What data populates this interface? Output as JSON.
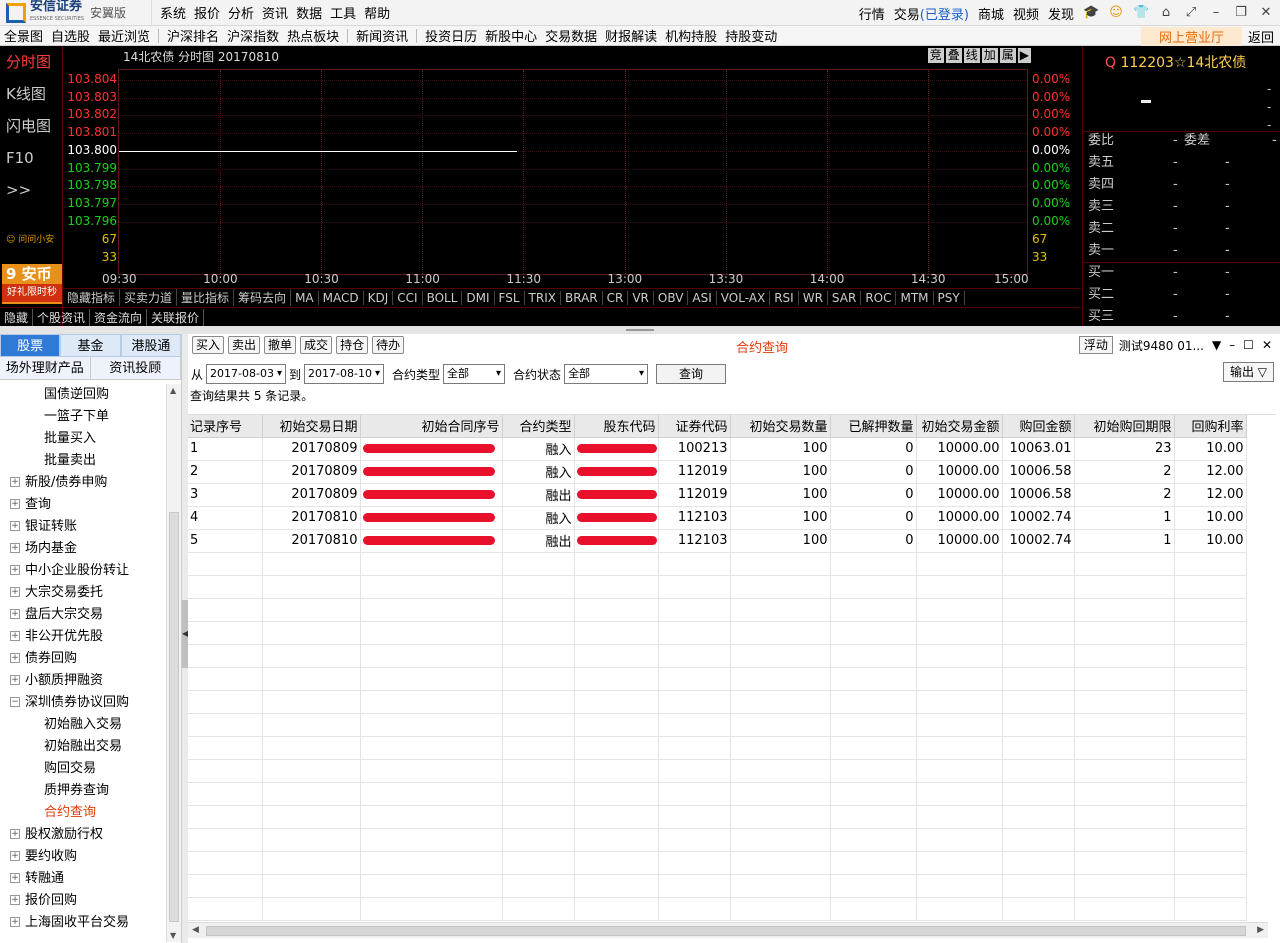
{
  "app": {
    "brand": "安信证券",
    "brand_en": "ESSENCE SECURITIES",
    "edition": "安翼版"
  },
  "menu": [
    "系统",
    "报价",
    "分析",
    "资讯",
    "数据",
    "工具",
    "帮助"
  ],
  "topright": {
    "market": "行情",
    "trade": "交易",
    "login_status": "(已登录)",
    "mall": "商城",
    "video": "视频",
    "discover": "发现"
  },
  "nav": {
    "items": [
      "全景图",
      "自选股",
      "最近浏览",
      "沪深排名",
      "沪深指数",
      "热点板块",
      "新闻资讯",
      "投资日历",
      "新股中心",
      "交易数据",
      "财报解读",
      "机构持股",
      "持股变动"
    ],
    "online_hall": "网上营业厅",
    "back": "返回"
  },
  "left_tabs": [
    "分时图",
    "K线图",
    "闪电图",
    "F10",
    ">>"
  ],
  "ask": "问问小安",
  "coin": {
    "num": "9",
    "label": "安币",
    "promo": "好礼限时秒"
  },
  "chart": {
    "title": "14北农债 分时图 20170810",
    "tools": [
      "竞",
      "叠",
      "线",
      "加",
      "属",
      "▶"
    ]
  },
  "chart_data": {
    "type": "line",
    "title": "14北农债 分时图 20170810",
    "x_ticks": [
      "09:30",
      "10:00",
      "10:30",
      "11:00",
      "11:30",
      "13:00",
      "13:30",
      "14:00",
      "14:30",
      "15:00"
    ],
    "y_ticks": [
      "103.804",
      "103.803",
      "103.802",
      "103.801",
      "103.800",
      "103.799",
      "103.798",
      "103.797",
      "103.796"
    ],
    "pct_ticks": [
      "0.00%",
      "0.00%",
      "0.00%",
      "0.00%",
      "0.00%",
      "0.00%",
      "0.00%",
      "0.00%",
      "0.00%"
    ],
    "volume_ticks": [
      "67",
      "33"
    ],
    "ylim": [
      103.796,
      103.804
    ],
    "series": [
      {
        "x": [
          "09:30",
          "11:15"
        ],
        "y": [
          103.8,
          103.8
        ]
      }
    ],
    "colors": {
      "up": "#ff3030",
      "flat": "#ffffff",
      "down": "#19d019",
      "volume": "#e0c000"
    }
  },
  "indicators": [
    "隐藏指标",
    "买卖力道",
    "量比指标",
    "筹码去向",
    "MA",
    "MACD",
    "KDJ",
    "CCI",
    "BOLL",
    "DMI",
    "FSL",
    "TRIX",
    "BRAR",
    "CR",
    "VR",
    "OBV",
    "ASI",
    "VOL-AX",
    "RSI",
    "WR",
    "SAR",
    "ROC",
    "MTM",
    "PSY"
  ],
  "subtabs": [
    "隐藏",
    "个股资讯",
    "资金流向",
    "关联报价"
  ],
  "quote": {
    "code": "112203",
    "name": "☆14北农债",
    "q": "Q",
    "commission_ratio": "委比",
    "commission_diff": "委差",
    "rows": [
      {
        "label": "卖五",
        "price": "-",
        "vol": "-"
      },
      {
        "label": "卖四",
        "price": "-",
        "vol": "-"
      },
      {
        "label": "卖三",
        "price": "-",
        "vol": "-"
      },
      {
        "label": "卖二",
        "price": "-",
        "vol": "-"
      },
      {
        "label": "卖一",
        "price": "-",
        "vol": "-"
      },
      {
        "label": "买一",
        "price": "-",
        "vol": "-"
      },
      {
        "label": "买二",
        "price": "-",
        "vol": "-"
      },
      {
        "label": "买三",
        "price": "-",
        "vol": "-"
      }
    ]
  },
  "categories": {
    "tabs": [
      "股票",
      "基金",
      "港股通"
    ],
    "tabs2": [
      "场外理财产品",
      "资讯投顾"
    ]
  },
  "tree": [
    {
      "type": "child",
      "label": "国债逆回购"
    },
    {
      "type": "child",
      "label": "一篮子下单"
    },
    {
      "type": "child",
      "label": "批量买入"
    },
    {
      "type": "child",
      "label": "批量卖出"
    },
    {
      "type": "parent",
      "pm": "+",
      "label": "新股/债券申购"
    },
    {
      "type": "parent",
      "pm": "+",
      "label": "查询"
    },
    {
      "type": "parent",
      "pm": "+",
      "label": "银证转账"
    },
    {
      "type": "parent",
      "pm": "+",
      "label": "场内基金"
    },
    {
      "type": "parent",
      "pm": "+",
      "label": "中小企业股份转让"
    },
    {
      "type": "parent",
      "pm": "+",
      "label": "大宗交易委托"
    },
    {
      "type": "parent",
      "pm": "+",
      "label": "盘后大宗交易"
    },
    {
      "type": "parent",
      "pm": "+",
      "label": "非公开优先股"
    },
    {
      "type": "parent",
      "pm": "+",
      "label": "债券回购"
    },
    {
      "type": "parent",
      "pm": "+",
      "label": "小额质押融资"
    },
    {
      "type": "parent",
      "pm": "−",
      "label": "深圳债券协议回购"
    },
    {
      "type": "child",
      "label": "初始融入交易"
    },
    {
      "type": "child",
      "label": "初始融出交易"
    },
    {
      "type": "child",
      "label": "购回交易"
    },
    {
      "type": "child",
      "label": "质押券查询"
    },
    {
      "type": "child",
      "label": "合约查询",
      "selected": true
    },
    {
      "type": "parent",
      "pm": "+",
      "label": "股权激励行权"
    },
    {
      "type": "parent",
      "pm": "+",
      "label": "要约收购"
    },
    {
      "type": "parent",
      "pm": "+",
      "label": "转融通"
    },
    {
      "type": "parent",
      "pm": "+",
      "label": "报价回购"
    },
    {
      "type": "parent",
      "pm": "+",
      "label": "上海固收平台交易"
    }
  ],
  "actions": [
    "买入",
    "卖出",
    "撤单",
    "成交",
    "持仓",
    "待办"
  ],
  "form": {
    "title": "合约查询",
    "float": "浮动",
    "account": "测试9480 01..."
  },
  "filters": {
    "from_label": "从",
    "from": "2017-08-03",
    "to_label": "到",
    "to": "2017-08-10",
    "type_label": "合约类型",
    "type": "全部",
    "status_label": "合约状态",
    "status": "全部",
    "query": "查询",
    "export": "输出 ▽"
  },
  "result_info": "查询结果共 5 条记录。",
  "table": {
    "columns": [
      "记录序号",
      "初始交易日期",
      "初始合同序号",
      "合约类型",
      "股东代码",
      "证券代码",
      "初始交易数量",
      "已解押数量",
      "初始交易金额",
      "购回金额",
      "初始购回期限",
      "回购利率"
    ],
    "rows": [
      [
        "1",
        "20170809",
        "",
        "融入",
        "",
        "100213",
        "100",
        "0",
        "10000.00",
        "10063.01",
        "23",
        "10.00"
      ],
      [
        "2",
        "20170809",
        "",
        "融入",
        "",
        "112019",
        "100",
        "0",
        "10000.00",
        "10006.58",
        "2",
        "12.00"
      ],
      [
        "3",
        "20170809",
        "",
        "融出",
        "",
        "112019",
        "100",
        "0",
        "10000.00",
        "10006.58",
        "2",
        "12.00"
      ],
      [
        "4",
        "20170810",
        "",
        "融入",
        "",
        "112103",
        "100",
        "0",
        "10000.00",
        "10002.74",
        "1",
        "10.00"
      ],
      [
        "5",
        "20170810",
        "",
        "融出",
        "",
        "112103",
        "100",
        "0",
        "10000.00",
        "10002.74",
        "1",
        "10.00"
      ]
    ]
  }
}
